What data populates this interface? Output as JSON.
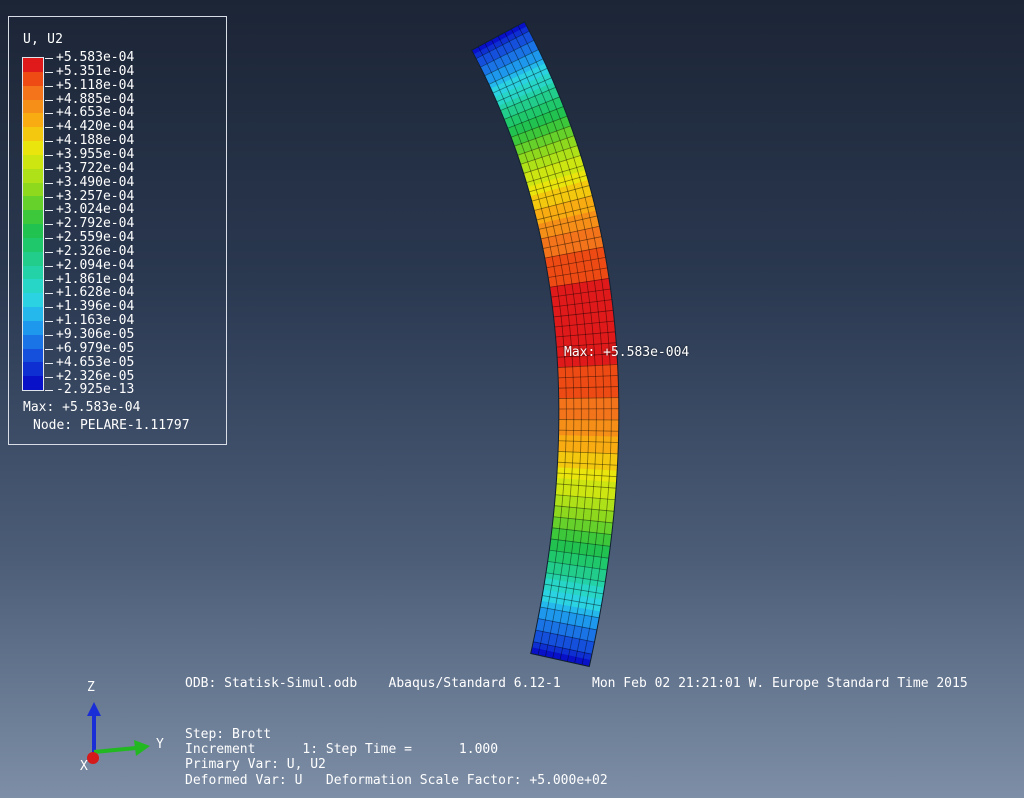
{
  "legend": {
    "title": "U, U2",
    "labels": [
      "+5.583e-04",
      "+5.351e-04",
      "+5.118e-04",
      "+4.885e-04",
      "+4.653e-04",
      "+4.420e-04",
      "+4.188e-04",
      "+3.955e-04",
      "+3.722e-04",
      "+3.490e-04",
      "+3.257e-04",
      "+3.024e-04",
      "+2.792e-04",
      "+2.559e-04",
      "+2.326e-04",
      "+2.094e-04",
      "+1.861e-04",
      "+1.628e-04",
      "+1.396e-04",
      "+1.163e-04",
      "+9.306e-05",
      "+6.979e-05",
      "+4.653e-05",
      "+2.326e-05",
      "-2.925e-13"
    ],
    "colors": [
      "#e01a1a",
      "#ee4a14",
      "#f3741a",
      "#f68f18",
      "#f8ac12",
      "#f3c80e",
      "#eae50c",
      "#cde612",
      "#aee118",
      "#8ed81e",
      "#66d12a",
      "#3cc83a",
      "#22c250",
      "#20c86c",
      "#22cc8a",
      "#24d2a8",
      "#28d6c8",
      "#2ad2e2",
      "#24b8ec",
      "#1e98ec",
      "#1a74e6",
      "#1450dc",
      "#0e30d2",
      "#0810c8"
    ],
    "max_text": "Max: +5.583e-04",
    "node_text": "Node: PELARE-1.11797"
  },
  "viewport": {
    "max_annotation": "Max: +5.583e-004"
  },
  "info": {
    "odb_line": "ODB: Statisk-Simul.odb    Abaqus/Standard 6.12-1    Mon Feb 02 21:21:01 W. Europe Standard Time 2015",
    "step_line": "Step: Brott",
    "increment_line": "Increment      1: Step Time =      1.000",
    "primary_var_line": "Primary Var: U, U2",
    "deformed_var_line": "Deformed Var: U   Deformation Scale Factor: +5.000e+02"
  },
  "triad": {
    "z_label": "Z",
    "y_label": "Y",
    "x_label": "X",
    "z_color": "#1a2ed8",
    "y_color": "#22b822",
    "x_color": "#d41a1a"
  }
}
